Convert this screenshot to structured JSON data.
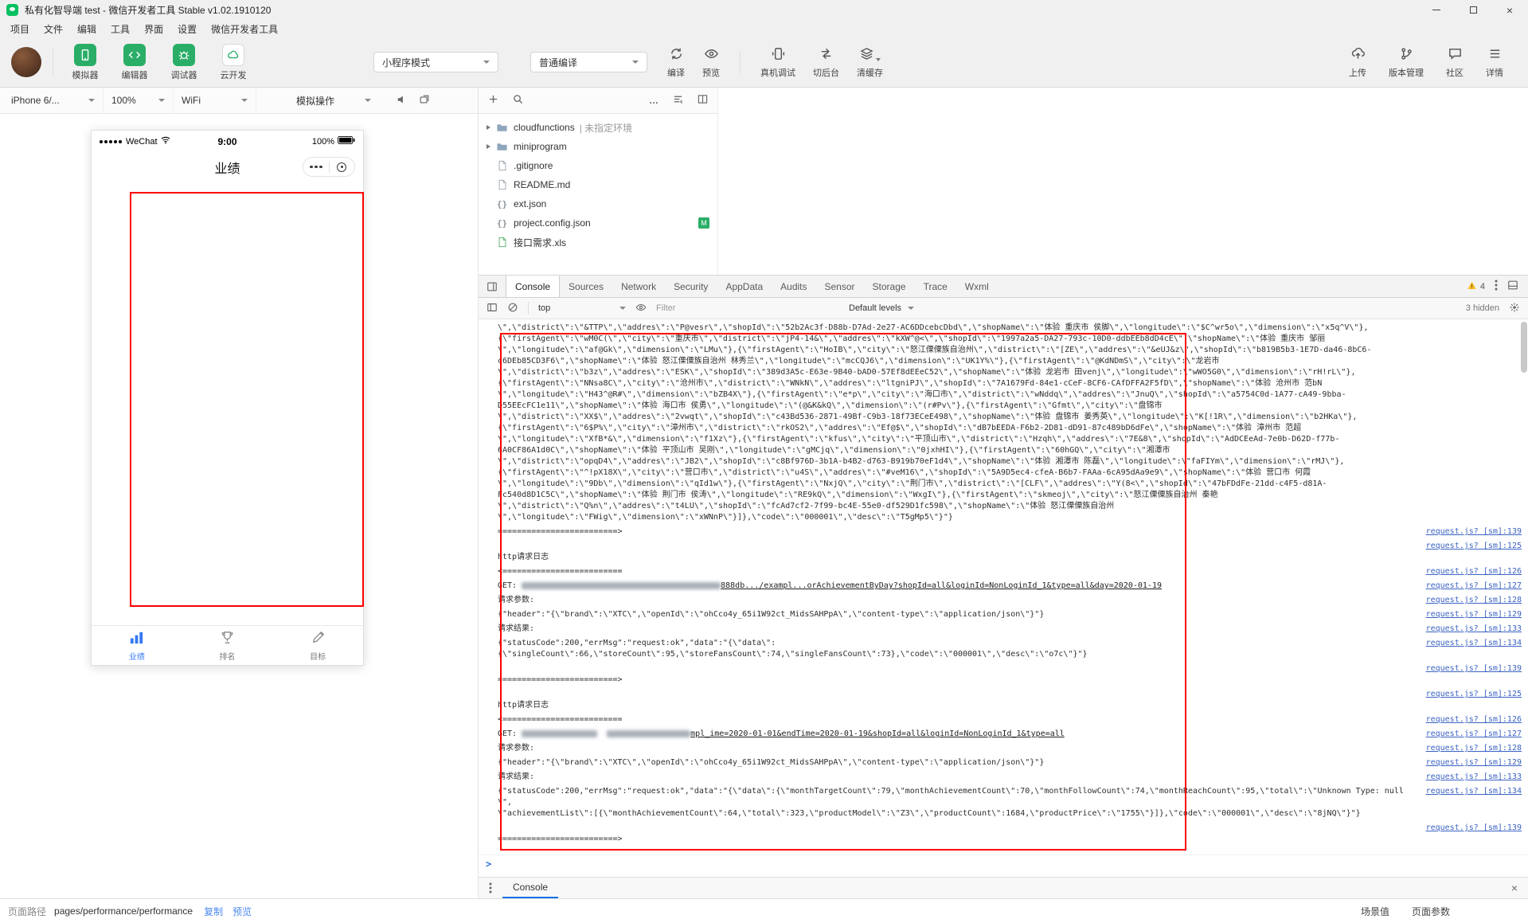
{
  "titlebar": {
    "title": "私有化智导端  test - 微信开发者工具 Stable v1.02.1910120"
  },
  "menubar": {
    "items": [
      "项目",
      "文件",
      "编辑",
      "工具",
      "界面",
      "设置",
      "微信开发者工具"
    ]
  },
  "toolbar": {
    "simulator": "模拟器",
    "editor": "编辑器",
    "debugger": "调试器",
    "cloud": "云开发",
    "mode_select": "小程序模式",
    "compile_select": "普通编译",
    "compile": "编译",
    "preview": "预览",
    "remote_debug": "真机调试",
    "switch_background": "切后台",
    "clear_cache": "清缓存",
    "upload": "上传",
    "version": "版本管理",
    "community": "社区",
    "details": "详情"
  },
  "sim_toolbar": {
    "device": "iPhone 6/...",
    "zoom": "100%",
    "network": "WiFi",
    "simulate": "模拟操作"
  },
  "phone": {
    "carrier": "WeChat",
    "time": "9:00",
    "battery": "100%",
    "nav_title": "业绩",
    "tabs": {
      "performance": "业绩",
      "ranking": "排名",
      "target": "目标"
    }
  },
  "file_tree": {
    "items": [
      {
        "name": "cloudfunctions",
        "suffix": "| 未指定环境",
        "type": "folder",
        "chevron": true
      },
      {
        "name": "miniprogram",
        "type": "folder",
        "chevron": true
      },
      {
        "name": ".gitignore",
        "type": "file"
      },
      {
        "name": "README.md",
        "type": "file"
      },
      {
        "name": "ext.json",
        "type": "braces"
      },
      {
        "name": "project.config.json",
        "type": "braces",
        "badge": "M"
      },
      {
        "name": "接口需求.xls",
        "type": "xls"
      }
    ]
  },
  "devtools": {
    "tabs": [
      "Console",
      "Sources",
      "Network",
      "Security",
      "AppData",
      "Audits",
      "Sensor",
      "Storage",
      "Trace",
      "Wxml"
    ],
    "active_tab": "Console",
    "warning_count": "4",
    "context": "top",
    "filter_placeholder": "Filter",
    "levels": "Default levels",
    "hidden_note": "3 hidden"
  },
  "console": {
    "prompt": ">",
    "entries": [
      {
        "link": null,
        "lines": [
          "\\\",\\\"district\\\":\\\"&TTP\\\",\\\"addres\\\":\\\"P@vesr\\\",\\\"shopId\\\":\\\"52b2Ac3f-D88b-D7Ad-2e27-AC6DDcebcDbd\\\",\\\"shopName\\\":\\\"体验 重庆市 侯脚\\\",\\\"longitude\\\":\\\"$C^wr5o\\\",\\\"dimension\\\":\\\"x5q^V\\\"},",
          "{\\\"firstAgent\\\":\\\"wM0C(\\\",\\\"city\\\":\\\"重庆市\\\",\\\"district\\\":\\\"jP4-14&\\\",\\\"addres\\\":\\\"kXW^@<\\\",\\\"shopId\\\":\\\"1997a2a5-DA27-793c-10D0-ddbEEb8dD4cE\\\",\\\"shopName\\\":\\\"体验 重庆市 邹丽",
          "\\\",\\\"longitude\\\":\\\"af@Gk\\\",\\\"dimension\\\":\\\"LMu\\\"},{\\\"firstAgent\\\":\\\"HoIB\\\",\\\"city\\\":\\\"怒江傈僳族自治州\\\",\\\"district\\\":\\\"[ZE\\\",\\\"addres\\\":\\\"&eUJ&z\\\",\\\"shopId\\\":\\\"b819B5b3-1E7D-da46-8bC6-",
          "c6DEb85CD3F6\\\",\\\"shopName\\\":\\\"体验 怒江傈僳族自治州 林秀兰\\\",\\\"longitude\\\":\\\"mcCQJ6\\\",\\\"dimension\\\":\\\"UK1Y%\\\"},{\\\"firstAgent\\\":\\\"@KdNDmS\\\",\\\"city\\\":\\\"龙岩市",
          "\\\",\\\"district\\\":\\\"b3z\\\",\\\"addres\\\":\\\"ESK\\\",\\\"shopId\\\":\\\"389d3A5c-E63e-9B40-bAD0-57Ef8dEEeC52\\\",\\\"shopName\\\":\\\"体验 龙岩市 田venj\\\",\\\"longitude\\\":\\\"wWO5G0\\\",\\\"dimension\\\":\\\"rH!rL\\\"},",
          "{\\\"firstAgent\\\":\\\"NNsa8C\\\",\\\"city\\\":\\\"沧州市\\\",\\\"district\\\":\\\"WNkN\\\",\\\"addres\\\":\\\"ltgniPJ\\\",\\\"shopId\\\":\\\"7A1679Fd-84e1-cCeF-8CF6-CAfDFFA2F5fD\\\",\\\"shopName\\\":\\\"体验 沧州市 范bN",
          "\\\",\\\"longitude\\\":\\\"H43^@R#\\\",\\\"dimension\\\":\\\"bZB4X\\\"},{\\\"firstAgent\\\":\\\"e*p\\\",\\\"city\\\":\\\"海口市\\\",\\\"district\\\":\\\"wNddq\\\",\\\"addres\\\":\\\"JnuQ\\\",\\\"shopId\\\":\\\"a5754C0d-1A77-cA49-9bba-",
          "D55EEcFC1e11\\\",\\\"shopName\\\":\\\"体验 海口市 侯勇\\\",\\\"longitude\\\":\\\"(@&K&kQ\\\",\\\"dimension\\\":\\\"(r#Pv\\\"},{\\\"firstAgent\\\":\\\"Gfmt\\\",\\\"city\\\":\\\"盘锦市",
          "\\\",\\\"district\\\":\\\"XX$\\\",\\\"addres\\\":\\\"2vwqt\\\",\\\"shopId\\\":\\\"c43Bd536-2871-49Bf-C9b3-18f73ECeE498\\\",\\\"shopName\\\":\\\"体验 盘锦市 姜秀英\\\",\\\"longitude\\\":\\\"K[!1R\\\",\\\"dimension\\\":\\\"b2HKa\\\"},",
          "{\\\"firstAgent\\\":\\\"6$P%\\\",\\\"city\\\":\\\"漳州市\\\",\\\"district\\\":\\\"rkOS2\\\",\\\"addres\\\":\\\"Ef@$\\\",\\\"shopId\\\":\\\"dB7bEEDA-F6b2-2D81-dD91-87c489bD6dFe\\\",\\\"shopName\\\":\\\"体验 漳州市 范超",
          "\\\",\\\"longitude\\\":\\\"XfB*&\\\",\\\"dimension\\\":\\\"f1Xz\\\"},{\\\"firstAgent\\\":\\\"kfus\\\",\\\"city\\\":\\\"平顶山市\\\",\\\"district\\\":\\\"Hzqh\\\",\\\"addres\\\":\\\"7E&8\\\",\\\"shopId\\\":\\\"AdDCEeAd-7e0b-D62D-f77b-",
          "6A0CF86A1d0C\\\",\\\"shopName\\\":\\\"体验 平顶山市 吴刚\\\",\\\"longitude\\\":\\\"gMCjq\\\",\\\"dimension\\\":\\\"0jxhHI\\\"},{\\\"firstAgent\\\":\\\"60hGQ\\\",\\\"city\\\":\\\"湘潭市",
          "\\\",\\\"district\\\":\\\"opqD4\\\",\\\"addres\\\":\\\"JB2\\\",\\\"shopId\\\":\\\"c8Bf976D-3b1A-b4B2-d763-B919b70eF1d4\\\",\\\"shopName\\\":\\\"体验 湘潭市 陈磊\\\",\\\"longitude\\\":\\\"faFIYm\\\",\\\"dimension\\\":\\\"rMJ\\\"},",
          "{\\\"firstAgent\\\":\\\"^!pX18X\\\",\\\"city\\\":\\\"营口市\\\",\\\"district\\\":\\\"u4S\\\",\\\"addres\\\":\\\"#veM16\\\",\\\"shopId\\\":\\\"5A9D5ec4-cfeA-B6b7-FAAa-6cA95dAa9e9\\\",\\\"shopName\\\":\\\"体验 营口市 何霞",
          "\\\",\\\"longitude\\\":\\\"9Db\\\",\\\"dimension\\\":\\\"qId1w\\\"},{\\\"firstAgent\\\":\\\"NxjQ\\\",\\\"city\\\":\\\"荆门市\\\",\\\"district\\\":\\\"[CLF\\\",\\\"addres\\\":\\\"Y(8<\\\",\\\"shopId\\\":\\\"47bFDdFe-21dd-c4F5-d81A-",
          "Fc540d8D1C5C\\\",\\\"shopName\\\":\\\"体验 荆门市 侯涛\\\",\\\"longitude\\\":\\\"RE9kQ\\\",\\\"dimension\\\":\\\"WxgI\\\"},{\\\"firstAgent\\\":\\\"skmeoj\\\",\\\"city\\\":\\\"怒江傈僳族自治州 秦艳",
          "\\\",\\\"district\\\":\\\"Q%n\\\",\\\"addres\\\":\\\"t4LU\\\",\\\"shopId\\\":\\\"fcAd7cf2-7f99-bc4E-55e0-df529D1fc598\\\",\\\"shopName\\\":\\\"体验 怒江傈僳族自治州",
          "\\\",\\\"longitude\\\":\\\"FWig\\\",\\\"dimension\\\":\\\"xWNnP\\\"}]},\\\"code\\\":\\\"000001\\\",\\\"desc\\\":\\\"T5gMp5\\\"}\"}"
        ]
      },
      {
        "link": "request.js? [sm]:139",
        "lines": [
          "=========================>"
        ]
      },
      {
        "link": "request.js? [sm]:125",
        "lines": [
          "",
          "http请求日志"
        ]
      },
      {
        "link": "request.js? [sm]:126",
        "lines": [
          "<========================="
        ]
      },
      {
        "link": "request.js? [sm]:127",
        "lines": [
          [
            {
              "t": "GET: "
            },
            {
              "b": 250
            },
            {
              "u": "888db.../exampl...orAchievementByDay?shopId=all&loginId=NonLoginId_1&type=all&day=2020-01-19"
            }
          ]
        ]
      },
      {
        "link": "request.js? [sm]:128",
        "lines": [
          "请求参数:"
        ]
      },
      {
        "link": "request.js? [sm]:129",
        "lines": [
          "{\"header\":\"{\\\"brand\\\":\\\"XTC\\\",\\\"openId\\\":\\\"ohCco4y_65i1W92ct_MidsSAHPpA\\\",\\\"content-type\\\":\\\"application/json\\\"}\"}"
        ]
      },
      {
        "link": "request.js? [sm]:133",
        "lines": [
          "请求结果:"
        ]
      },
      {
        "link": "request.js? [sm]:134",
        "lines": [
          "{\"statusCode\":200,\"errMsg\":\"request:ok\",\"data\":\"{\\\"data\\\":",
          "{\\\"singleCount\\\":66,\\\"storeCount\\\":95,\\\"storeFansCount\\\":74,\\\"singleFansCount\\\":73},\\\"code\\\":\\\"000001\\\",\\\"desc\\\":\\\"o7c\\\"}\"}"
        ]
      },
      {
        "link": "request.js? [sm]:139",
        "lines": [
          "",
          "=========================>"
        ]
      },
      {
        "link": "request.js? [sm]:125",
        "lines": [
          "",
          "http请求日志"
        ]
      },
      {
        "link": "request.js? [sm]:126",
        "lines": [
          "<========================="
        ]
      },
      {
        "link": "request.js? [sm]:127",
        "lines": [
          [
            {
              "t": "GET: "
            },
            {
              "b": 95
            },
            {
              "t": "  "
            },
            {
              "b": 105
            },
            {
              "u": "mpl_ime=2020-01-01&endTime=2020-01-19&shopId=all&loginId=NonLoginId_1&type=all"
            }
          ]
        ]
      },
      {
        "link": "request.js? [sm]:128",
        "lines": [
          "请求参数:"
        ]
      },
      {
        "link": "request.js? [sm]:129",
        "lines": [
          "{\"header\":\"{\\\"brand\\\":\\\"XTC\\\",\\\"openId\\\":\\\"ohCco4y_65i1W92ct_MidsSAHPpA\\\",\\\"content-type\\\":\\\"application/json\\\"}\"}"
        ]
      },
      {
        "link": "request.js? [sm]:133",
        "lines": [
          "请求结果:"
        ]
      },
      {
        "link": "request.js? [sm]:134",
        "lines": [
          "{\"statusCode\":200,\"errMsg\":\"request:ok\",\"data\":\"{\\\"data\\\":{\\\"monthTargetCount\\\":79,\\\"monthAchievementCount\\\":70,\\\"monthFollowCount\\\":74,\\\"monthReachCount\\\":95,\\\"total\\\":\\\"Unknown Type: null\\\",",
          "\\\"achievementList\\\":[{\\\"monthAchievementCount\\\":64,\\\"total\\\":323,\\\"productModel\\\":\\\"Z3\\\",\\\"productCount\\\":1684,\\\"productPrice\\\":\\\"1755\\\"}]},\\\"code\\\":\\\"000001\\\",\\\"desc\\\":\\\"8jNQ\\\"}\"}"
        ]
      },
      {
        "link": "request.js? [sm]:139",
        "lines": [
          "",
          "=========================>"
        ]
      }
    ]
  },
  "drawer": {
    "tab": "Console"
  },
  "statusbar": {
    "path_label": "页面路径",
    "path": "pages/performance/performance",
    "copy": "复制",
    "preview": "预览",
    "scene": "场景值",
    "page_params": "页面参数"
  }
}
